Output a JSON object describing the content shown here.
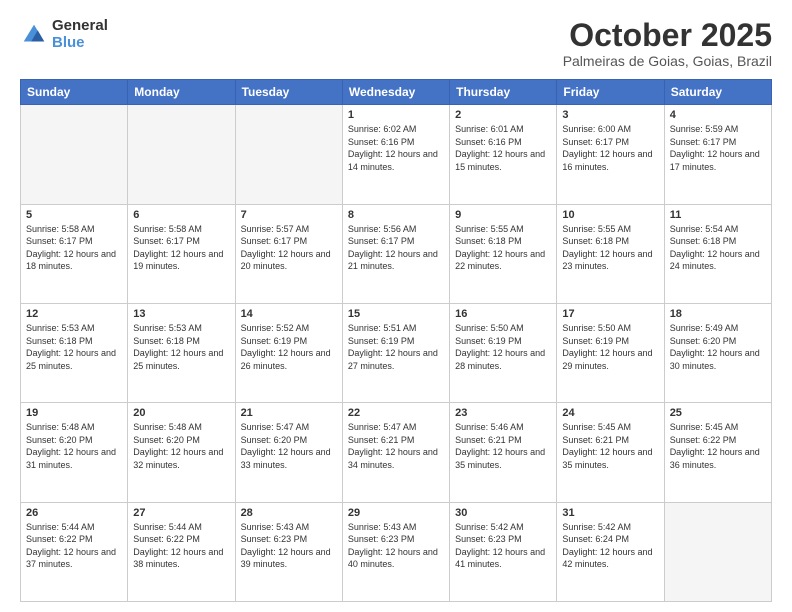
{
  "header": {
    "logo_general": "General",
    "logo_blue": "Blue",
    "month_title": "October 2025",
    "location": "Palmeiras de Goias, Goias, Brazil"
  },
  "columns": [
    "Sunday",
    "Monday",
    "Tuesday",
    "Wednesday",
    "Thursday",
    "Friday",
    "Saturday"
  ],
  "weeks": [
    [
      {
        "day": "",
        "info": ""
      },
      {
        "day": "",
        "info": ""
      },
      {
        "day": "",
        "info": ""
      },
      {
        "day": "1",
        "info": "Sunrise: 6:02 AM\nSunset: 6:16 PM\nDaylight: 12 hours and 14 minutes."
      },
      {
        "day": "2",
        "info": "Sunrise: 6:01 AM\nSunset: 6:16 PM\nDaylight: 12 hours and 15 minutes."
      },
      {
        "day": "3",
        "info": "Sunrise: 6:00 AM\nSunset: 6:17 PM\nDaylight: 12 hours and 16 minutes."
      },
      {
        "day": "4",
        "info": "Sunrise: 5:59 AM\nSunset: 6:17 PM\nDaylight: 12 hours and 17 minutes."
      }
    ],
    [
      {
        "day": "5",
        "info": "Sunrise: 5:58 AM\nSunset: 6:17 PM\nDaylight: 12 hours and 18 minutes."
      },
      {
        "day": "6",
        "info": "Sunrise: 5:58 AM\nSunset: 6:17 PM\nDaylight: 12 hours and 19 minutes."
      },
      {
        "day": "7",
        "info": "Sunrise: 5:57 AM\nSunset: 6:17 PM\nDaylight: 12 hours and 20 minutes."
      },
      {
        "day": "8",
        "info": "Sunrise: 5:56 AM\nSunset: 6:17 PM\nDaylight: 12 hours and 21 minutes."
      },
      {
        "day": "9",
        "info": "Sunrise: 5:55 AM\nSunset: 6:18 PM\nDaylight: 12 hours and 22 minutes."
      },
      {
        "day": "10",
        "info": "Sunrise: 5:55 AM\nSunset: 6:18 PM\nDaylight: 12 hours and 23 minutes."
      },
      {
        "day": "11",
        "info": "Sunrise: 5:54 AM\nSunset: 6:18 PM\nDaylight: 12 hours and 24 minutes."
      }
    ],
    [
      {
        "day": "12",
        "info": "Sunrise: 5:53 AM\nSunset: 6:18 PM\nDaylight: 12 hours and 25 minutes."
      },
      {
        "day": "13",
        "info": "Sunrise: 5:53 AM\nSunset: 6:18 PM\nDaylight: 12 hours and 25 minutes."
      },
      {
        "day": "14",
        "info": "Sunrise: 5:52 AM\nSunset: 6:19 PM\nDaylight: 12 hours and 26 minutes."
      },
      {
        "day": "15",
        "info": "Sunrise: 5:51 AM\nSunset: 6:19 PM\nDaylight: 12 hours and 27 minutes."
      },
      {
        "day": "16",
        "info": "Sunrise: 5:50 AM\nSunset: 6:19 PM\nDaylight: 12 hours and 28 minutes."
      },
      {
        "day": "17",
        "info": "Sunrise: 5:50 AM\nSunset: 6:19 PM\nDaylight: 12 hours and 29 minutes."
      },
      {
        "day": "18",
        "info": "Sunrise: 5:49 AM\nSunset: 6:20 PM\nDaylight: 12 hours and 30 minutes."
      }
    ],
    [
      {
        "day": "19",
        "info": "Sunrise: 5:48 AM\nSunset: 6:20 PM\nDaylight: 12 hours and 31 minutes."
      },
      {
        "day": "20",
        "info": "Sunrise: 5:48 AM\nSunset: 6:20 PM\nDaylight: 12 hours and 32 minutes."
      },
      {
        "day": "21",
        "info": "Sunrise: 5:47 AM\nSunset: 6:20 PM\nDaylight: 12 hours and 33 minutes."
      },
      {
        "day": "22",
        "info": "Sunrise: 5:47 AM\nSunset: 6:21 PM\nDaylight: 12 hours and 34 minutes."
      },
      {
        "day": "23",
        "info": "Sunrise: 5:46 AM\nSunset: 6:21 PM\nDaylight: 12 hours and 35 minutes."
      },
      {
        "day": "24",
        "info": "Sunrise: 5:45 AM\nSunset: 6:21 PM\nDaylight: 12 hours and 35 minutes."
      },
      {
        "day": "25",
        "info": "Sunrise: 5:45 AM\nSunset: 6:22 PM\nDaylight: 12 hours and 36 minutes."
      }
    ],
    [
      {
        "day": "26",
        "info": "Sunrise: 5:44 AM\nSunset: 6:22 PM\nDaylight: 12 hours and 37 minutes."
      },
      {
        "day": "27",
        "info": "Sunrise: 5:44 AM\nSunset: 6:22 PM\nDaylight: 12 hours and 38 minutes."
      },
      {
        "day": "28",
        "info": "Sunrise: 5:43 AM\nSunset: 6:23 PM\nDaylight: 12 hours and 39 minutes."
      },
      {
        "day": "29",
        "info": "Sunrise: 5:43 AM\nSunset: 6:23 PM\nDaylight: 12 hours and 40 minutes."
      },
      {
        "day": "30",
        "info": "Sunrise: 5:42 AM\nSunset: 6:23 PM\nDaylight: 12 hours and 41 minutes."
      },
      {
        "day": "31",
        "info": "Sunrise: 5:42 AM\nSunset: 6:24 PM\nDaylight: 12 hours and 42 minutes."
      },
      {
        "day": "",
        "info": ""
      }
    ]
  ]
}
